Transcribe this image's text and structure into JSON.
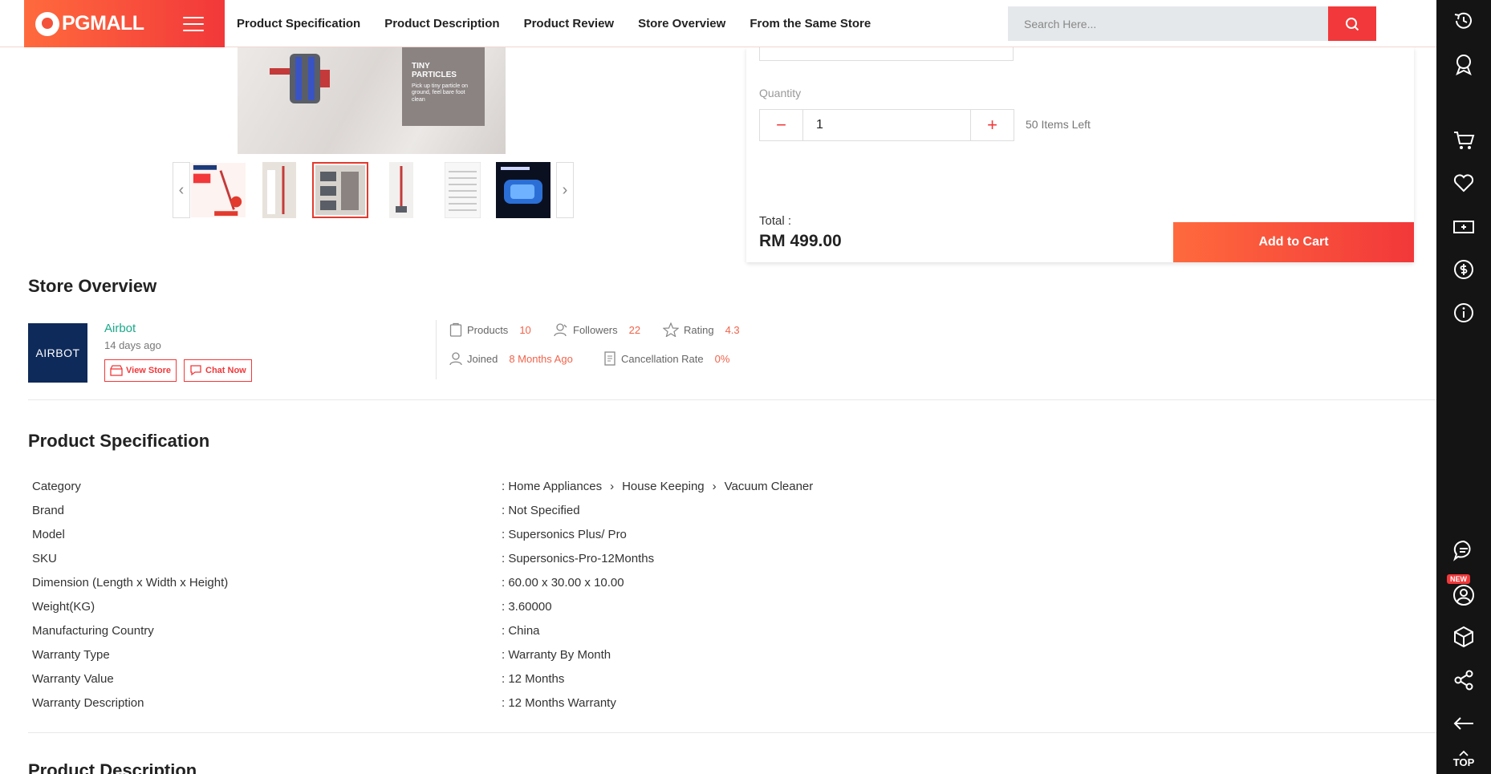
{
  "header": {
    "logo_text": "PGMALL",
    "nav": [
      {
        "label": "Product Specification"
      },
      {
        "label": "Product Description"
      },
      {
        "label": "Product Review"
      },
      {
        "label": "Store Overview"
      },
      {
        "label": "From the Same Store"
      }
    ],
    "search_placeholder": "Search Here..."
  },
  "gallery": {
    "main_caption_title": "TINY PARTICLES",
    "main_caption_text": "Pick up tiny particle on ground, feel bare foot clean"
  },
  "purchase": {
    "quantity_label": "Quantity",
    "quantity_value": "1",
    "stock_text": "50 Items Left",
    "total_label": "Total :",
    "total_value": "RM 499.00",
    "add_to_cart_label": "Add to Cart"
  },
  "store": {
    "section_title": "Store Overview",
    "logo_text": "AIRBOT",
    "name": "Airbot",
    "since": "14 days ago",
    "view_store_label": "View Store",
    "chat_now_label": "Chat Now",
    "stats": {
      "products_label": "Products",
      "products_value": "10",
      "followers_label": "Followers",
      "followers_value": "22",
      "rating_label": "Rating",
      "rating_value": "4.3",
      "joined_label": "Joined",
      "joined_value": "8 Months Ago",
      "cancellation_label": "Cancellation Rate",
      "cancellation_value": "0%"
    }
  },
  "spec": {
    "section_title": "Product Specification",
    "category_path": [
      "Home Appliances",
      "House Keeping",
      "Vacuum Cleaner"
    ],
    "rows": [
      {
        "key": "Category",
        "value": ""
      },
      {
        "key": "Brand",
        "value": ": Not Specified"
      },
      {
        "key": "Model",
        "value": ": Supersonics Plus/ Pro"
      },
      {
        "key": "SKU",
        "value": ": Supersonics-Pro-12Months"
      },
      {
        "key": "Dimension (Length x Width x Height)",
        "value": ": 60.00 x 30.00 x 10.00"
      },
      {
        "key": "Weight(KG)",
        "value": ": 3.60000"
      },
      {
        "key": "Manufacturing Country",
        "value": ": China"
      },
      {
        "key": "Warranty Type",
        "value": ": Warranty By Month"
      },
      {
        "key": "Warranty Value",
        "value": ": 12 Months"
      },
      {
        "key": "Warranty Description",
        "value": ": 12 Months Warranty"
      }
    ]
  },
  "description": {
    "section_title": "Product Description"
  },
  "sidebar": {
    "new_badge": "NEW",
    "top_label": "TOP"
  },
  "colors": {
    "brand": "#f2383a",
    "brand_gradient_start": "#ff6a3d",
    "store_name": "#1aa98a",
    "stat_value": "#f2634a",
    "sidebar_bg": "#141414"
  }
}
